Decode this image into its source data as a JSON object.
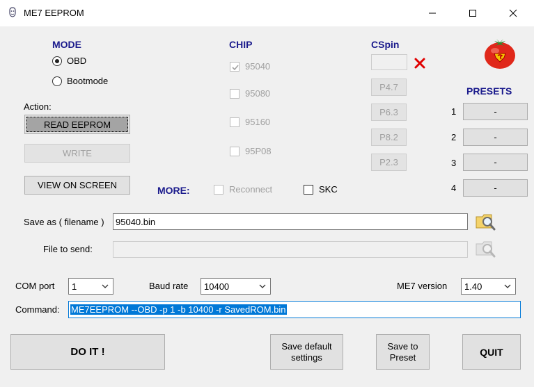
{
  "window": {
    "title": "ME7 EEPROM"
  },
  "mode": {
    "heading": "MODE",
    "options": [
      {
        "label": "OBD",
        "selected": true
      },
      {
        "label": "Bootmode",
        "selected": false
      }
    ]
  },
  "chip": {
    "heading": "CHIP",
    "options": [
      {
        "label": "95040",
        "checked": true
      },
      {
        "label": "95080",
        "checked": false
      },
      {
        "label": "95160",
        "checked": false
      },
      {
        "label": "95P08",
        "checked": false
      }
    ]
  },
  "cspin": {
    "heading": "CSpin",
    "value": "",
    "buttons": [
      "P4.7",
      "P6.3",
      "P8.2",
      "P2.3"
    ]
  },
  "presets": {
    "heading": "PRESETS",
    "items": [
      {
        "num": "1",
        "label": "-"
      },
      {
        "num": "2",
        "label": "-"
      },
      {
        "num": "3",
        "label": "-"
      },
      {
        "num": "4",
        "label": "-"
      }
    ]
  },
  "action": {
    "label": "Action:",
    "read": "READ EEPROM",
    "write": "WRITE",
    "view": "VIEW ON SCREEN"
  },
  "more": {
    "heading": "MORE:",
    "reconnect": {
      "label": "Reconnect",
      "checked": false
    },
    "skc": {
      "label": "SKC",
      "checked": false
    }
  },
  "files": {
    "save_as_label": "Save as ( filename )",
    "save_as_value": "95040.bin",
    "send_label": "File to send:",
    "send_value": ""
  },
  "settings": {
    "com_label": "COM port",
    "com_value": "1",
    "baud_label": "Baud rate",
    "baud_value": "10400",
    "version_label": "ME7 version",
    "version_value": "1.40"
  },
  "command": {
    "label": "Command:",
    "value": "ME7EEPROM --OBD -p 1 -b 10400 -r SavedROM.bin"
  },
  "footer": {
    "do_it": "DO IT !",
    "save_default_line1": "Save default",
    "save_default_line2": "settings",
    "save_preset_line1": "Save to",
    "save_preset_line2": "Preset",
    "quit": "QUIT"
  },
  "colors": {
    "heading": "#1a1a8c",
    "accent": "#0078d7",
    "cross": "#e00000",
    "tomato": "#e0281a"
  }
}
